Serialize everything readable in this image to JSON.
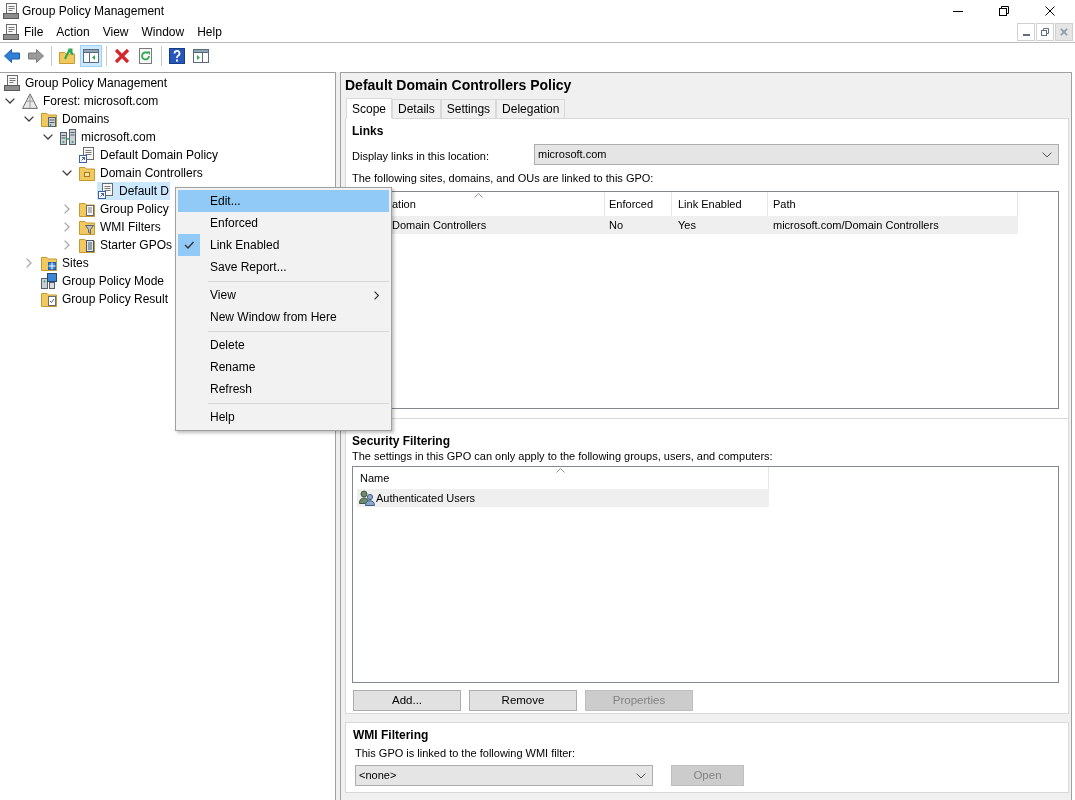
{
  "window": {
    "title": "Group Policy Management"
  },
  "menu_bar": [
    "File",
    "Action",
    "View",
    "Window",
    "Help"
  ],
  "toolbar": {
    "groups": [
      [
        {
          "kind": "back",
          "disabled": false,
          "pressed": false
        },
        {
          "kind": "forward",
          "disabled": true,
          "pressed": false
        }
      ],
      [
        {
          "kind": "up",
          "disabled": false,
          "pressed": false
        },
        {
          "kind": "console-tree",
          "disabled": false,
          "pressed": true
        }
      ],
      [
        {
          "kind": "delete",
          "disabled": false,
          "pressed": false
        },
        {
          "kind": "refresh",
          "disabled": false,
          "pressed": false
        }
      ],
      [
        {
          "kind": "help",
          "disabled": false,
          "pressed": false
        },
        {
          "kind": "action-pane",
          "disabled": false,
          "pressed": false
        }
      ]
    ]
  },
  "tree": {
    "items": [
      {
        "label": "Group Policy Management",
        "kind": "console",
        "selected": false,
        "children": [
          {
            "label": "Forest: microsoft.com",
            "kind": "forest",
            "expanded": true,
            "selected": false,
            "children": [
              {
                "label": "Domains",
                "kind": "domains",
                "expanded": true,
                "selected": false,
                "children": [
                  {
                    "label": "microsoft.com",
                    "kind": "domain",
                    "expanded": true,
                    "selected": false,
                    "children": [
                      {
                        "label": "Default Domain Policy",
                        "kind": "gpo-link",
                        "selected": false
                      },
                      {
                        "label": "Domain Controllers",
                        "kind": "ou",
                        "expanded": true,
                        "selected": false,
                        "children": [
                          {
                            "label": "Default D",
                            "kind": "gpo-link",
                            "selected": true
                          }
                        ]
                      },
                      {
                        "label": "Group Policy",
                        "kind": "gpo-container",
                        "expanded": false,
                        "selected": false
                      },
                      {
                        "label": "WMI Filters",
                        "kind": "wmi-container",
                        "expanded": false,
                        "selected": false
                      },
                      {
                        "label": "Starter GPOs",
                        "kind": "starter-container",
                        "expanded": false,
                        "selected": false
                      }
                    ]
                  }
                ]
              },
              {
                "label": "Sites",
                "kind": "sites",
                "expanded": false,
                "selected": false
              },
              {
                "label": "Group Policy Mode",
                "kind": "modeling",
                "selected": false
              },
              {
                "label": "Group Policy Result",
                "kind": "results",
                "selected": false
              }
            ]
          }
        ]
      }
    ]
  },
  "context_menu": {
    "groups": [
      [
        {
          "label": "Edit...",
          "selected": true,
          "checked": false,
          "submenu": false
        },
        {
          "label": "Enforced",
          "selected": false,
          "checked": false,
          "submenu": false
        },
        {
          "label": "Link Enabled",
          "selected": false,
          "checked": true,
          "submenu": false
        },
        {
          "label": "Save Report...",
          "selected": false,
          "checked": false,
          "submenu": false
        }
      ],
      [
        {
          "label": "View",
          "selected": false,
          "checked": false,
          "submenu": true
        },
        {
          "label": "New Window from Here",
          "selected": false,
          "checked": false,
          "submenu": false
        }
      ],
      [
        {
          "label": "Delete",
          "selected": false,
          "checked": false,
          "submenu": false
        },
        {
          "label": "Rename",
          "selected": false,
          "checked": false,
          "submenu": false
        },
        {
          "label": "Refresh",
          "selected": false,
          "checked": false,
          "submenu": false
        }
      ],
      [
        {
          "label": "Help",
          "selected": false,
          "checked": false,
          "submenu": false
        }
      ]
    ]
  },
  "details": {
    "title": "Default Domain Controllers Policy",
    "tabs": [
      {
        "label": "Scope",
        "selected": true
      },
      {
        "label": "Details",
        "selected": false
      },
      {
        "label": "Settings",
        "selected": false
      },
      {
        "label": "Delegation",
        "selected": false
      }
    ],
    "links": {
      "heading": "Links",
      "location_label": "Display links in this location:",
      "location": "microsoft.com",
      "caption": "The following sites, domains, and OUs are linked to this GPO:",
      "table": {
        "columns": [
          {
            "label": "ation",
            "sorted": true
          },
          {
            "label": "Enforced",
            "sorted": false
          },
          {
            "label": "Link Enabled",
            "sorted": false
          },
          {
            "label": "Path",
            "sorted": false
          }
        ],
        "rows": [
          {
            "cells": [
              "Domain Controllers",
              "No",
              "Yes",
              "microsoft.com/Domain Controllers"
            ],
            "selected": true
          }
        ]
      }
    },
    "security_filtering": {
      "heading": "Security Filtering",
      "caption": "The settings in this GPO can only apply to the following groups, users, and computers:",
      "table": {
        "columns": [
          {
            "label": "Name",
            "sorted": true
          }
        ],
        "rows": [
          {
            "name": "Authenticated Users",
            "selected": true
          }
        ]
      },
      "buttons": [
        {
          "label": "Add...",
          "disabled": false
        },
        {
          "label": "Remove",
          "disabled": false
        },
        {
          "label": "Properties",
          "disabled": true
        }
      ]
    },
    "wmi_filtering": {
      "heading": "WMI Filtering",
      "caption": "This GPO is linked to the following WMI filter:",
      "filter": "<none>",
      "button": {
        "label": "Open",
        "disabled": true
      }
    }
  }
}
